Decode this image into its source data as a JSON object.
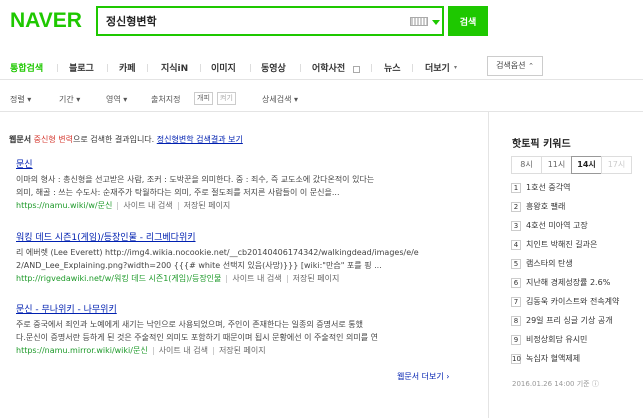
{
  "header": {
    "logo": "NAVER",
    "search_value": "정신형변학",
    "search_button": "검색"
  },
  "tabs": [
    {
      "label": "통합검색",
      "active": true
    },
    {
      "label": "블로그"
    },
    {
      "label": "카페"
    },
    {
      "label": "지식iN"
    },
    {
      "label": "이미지"
    },
    {
      "label": "동영상"
    },
    {
      "label": "어학사전"
    },
    {
      "label": "뉴스"
    },
    {
      "label": "더보기"
    }
  ],
  "options_button": "검색옵션",
  "filters": {
    "sort": "정렬",
    "period": "기간",
    "area": "영역",
    "source": "출처지정",
    "chip_on": "개피",
    "chip_off": "켜기",
    "detail": "상세검색"
  },
  "notice": {
    "prefix": "웹문서",
    "keyword": "중신형 변력",
    "middle": "으로 검색한 결과입니다.",
    "link": "정신형변학 검색결과 보기"
  },
  "results": [
    {
      "title": "문신",
      "desc1": "이마의 형사 : 총신형을 선고받은 사람, 조커 : 도박꾼을 의미한다. 중 : 죄수, 즉 교도소에 갔다온적이 있다는",
      "desc2": "의미, 해골 : 쓰는 수도사: 순재주가 탁월하다는 의미, 주로 절도죄를 저지른 사람들이 이 문신을...",
      "url": "https://namu.wiki/w/문신",
      "site_search": "사이트 내 검색",
      "cached": "저장된 페이지"
    },
    {
      "title": "워킹 데드 시즌1(게임)/등장인물 - 리그베다위키",
      "desc1": "리 에버렛 (Lee Everett) http://img4.wikia.nocookie.net/__cb20140406174342/walkingdead/images/e/e",
      "desc2": "2/AND_Lee_Explaining.png?width=200 {{{# white 선택지 있음(사망)}}} [wiki:\"만습\" 포를 핑 ...",
      "url": "http://rigvedawiki.net/w/워킹 데드 시즌1(게임)/등장인물",
      "site_search": "사이트 내 검색",
      "cached": "저장된 페이지"
    },
    {
      "title": "문신 - 무나위키 - 나무위키",
      "desc1": "주로 중국에서 죄인과 노예에게 새기는 낙인으로 사용되었으며, 주인이 존재한다는 일종의 증명서로 통했",
      "desc2": "다.문신이 증명서란 등하게 된 것은 주술적인 의미도 포함하기 때문이며 됩시 문황에선 이 주술적인 의미를 연",
      "url": "https://namu.mirror.wiki/wiki/문신",
      "site_search": "사이트 내 검색",
      "cached": "저장된 페이지"
    }
  ],
  "more_link": "웹문서 더보기",
  "hot_topics": {
    "title": "핫토픽 키워드",
    "hours": [
      "8시",
      "11시",
      "14시",
      "17시"
    ],
    "selected_hour": "14시",
    "items": [
      "1호선 중각역",
      "흥왕호 팰래",
      "4호선 미아역 고장",
      "치인트 박해진 길과은",
      "램스타의 탄생",
      "지난해 경제성장률 2.6%",
      "김동욱 카이스트와 전속계약",
      "29일 프리 싱글 기상 공개",
      "비정상회담 유시민",
      "녹십자 혈액제제"
    ],
    "timestamp": "2016.01.26 14:00 기준"
  }
}
